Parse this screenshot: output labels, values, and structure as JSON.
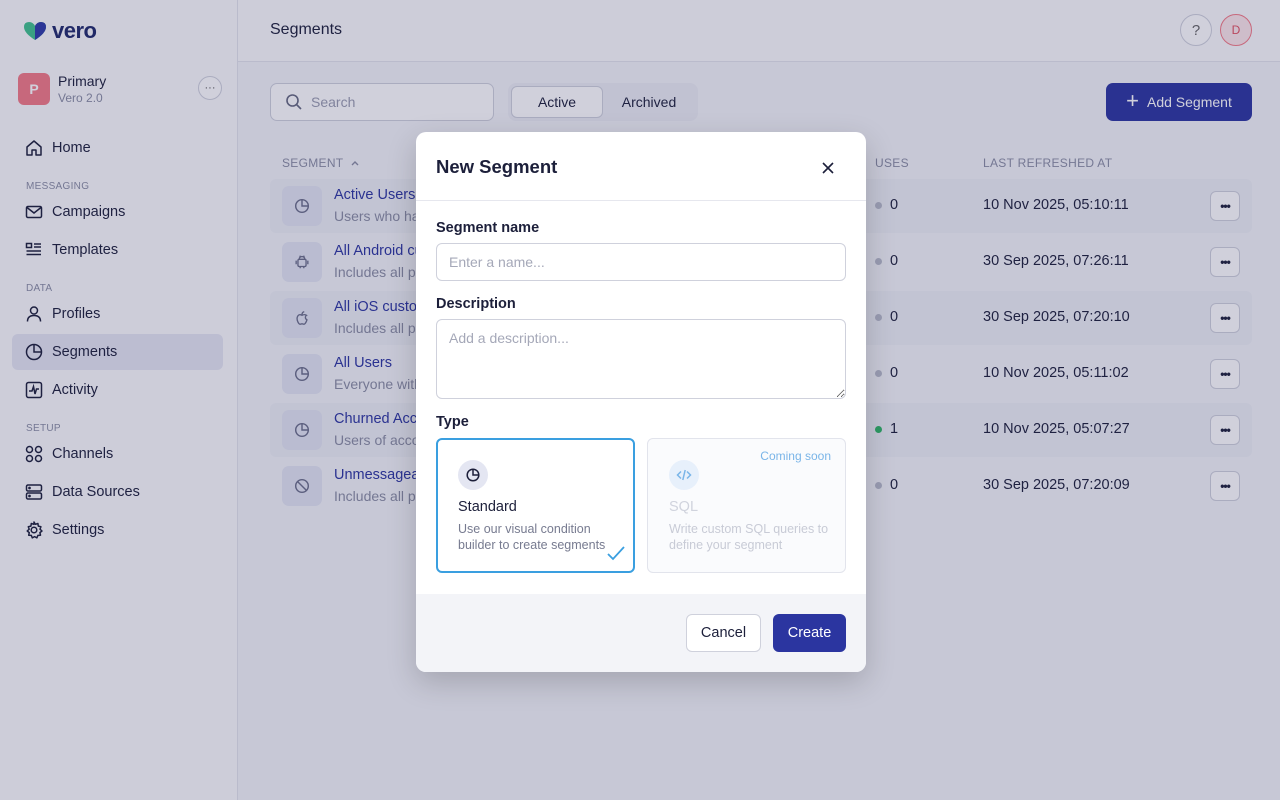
{
  "app": {
    "brand": "vero"
  },
  "workspace": {
    "initial": "P",
    "name": "Primary",
    "sub": "Vero 2.0",
    "more_label": "···"
  },
  "sidebar": {
    "items": [
      {
        "label": "Home",
        "icon": "home-icon"
      },
      {
        "section": "MESSAGING"
      },
      {
        "label": "Campaigns",
        "icon": "envelope-icon"
      },
      {
        "label": "Templates",
        "icon": "list-icon"
      },
      {
        "section": "DATA"
      },
      {
        "label": "Profiles",
        "icon": "person-icon"
      },
      {
        "label": "Segments",
        "icon": "pie-chart-icon",
        "active": true
      },
      {
        "label": "Activity",
        "icon": "activity-icon"
      },
      {
        "section": "SETUP"
      },
      {
        "label": "Channels",
        "icon": "channels-icon"
      },
      {
        "label": "Data Sources",
        "icon": "database-icon"
      },
      {
        "label": "Settings",
        "icon": "gear-icon"
      }
    ]
  },
  "header": {
    "title": "Segments",
    "help": "?",
    "user_initial": "D"
  },
  "toolbar": {
    "search_placeholder": "Search",
    "tabs": [
      {
        "label": "Active",
        "selected": true
      },
      {
        "label": "Archived",
        "selected": false
      }
    ],
    "add_label": "Add Segment"
  },
  "table": {
    "columns": {
      "segment": "SEGMENT",
      "uses": "USES",
      "refreshed": "LAST REFRESHED AT"
    },
    "rows": [
      {
        "name": "Active Users",
        "desc": "Users who have been active recently",
        "icon": "pie-chart-icon",
        "uses": "0",
        "uses_active": false,
        "refreshed": "10 Nov 2025, 05:10:11"
      },
      {
        "name": "All Android customers",
        "desc": "Includes all profiles with Android devices",
        "icon": "android-icon",
        "uses": "0",
        "uses_active": false,
        "refreshed": "30 Sep 2025, 07:26:11"
      },
      {
        "name": "All iOS customers",
        "desc": "Includes all profiles with iOS devices",
        "icon": "apple-icon",
        "uses": "0",
        "uses_active": false,
        "refreshed": "30 Sep 2025, 07:20:10"
      },
      {
        "name": "All Users",
        "desc": "Everyone with a profile",
        "icon": "pie-chart-icon",
        "uses": "0",
        "uses_active": false,
        "refreshed": "10 Nov 2025, 05:11:02"
      },
      {
        "name": "Churned Accounts",
        "desc": "Users of accounts that have churned",
        "icon": "pie-chart-icon",
        "uses": "1",
        "uses_active": true,
        "refreshed": "10 Nov 2025, 05:07:27"
      },
      {
        "name": "Unmessageable",
        "desc": "Includes all profiles that cannot be messaged",
        "icon": "block-icon",
        "uses": "0",
        "uses_active": false,
        "refreshed": "30 Sep 2025, 07:20:09"
      }
    ]
  },
  "modal": {
    "title": "New Segment",
    "name_label": "Segment name",
    "name_placeholder": "Enter a name...",
    "desc_label": "Description",
    "desc_placeholder": "Add a description...",
    "type_label": "Type",
    "types": [
      {
        "title": "Standard",
        "desc": "Use our visual condition builder to create segments",
        "selected": true
      },
      {
        "title": "SQL",
        "desc": "Write custom SQL queries to define your segment",
        "badge": "Coming soon",
        "disabled": true
      }
    ],
    "cancel_label": "Cancel",
    "create_label": "Create"
  },
  "colors": {
    "primary": "#2b35a0",
    "accent": "#3a9fe0",
    "avatar": "#f47a86"
  }
}
